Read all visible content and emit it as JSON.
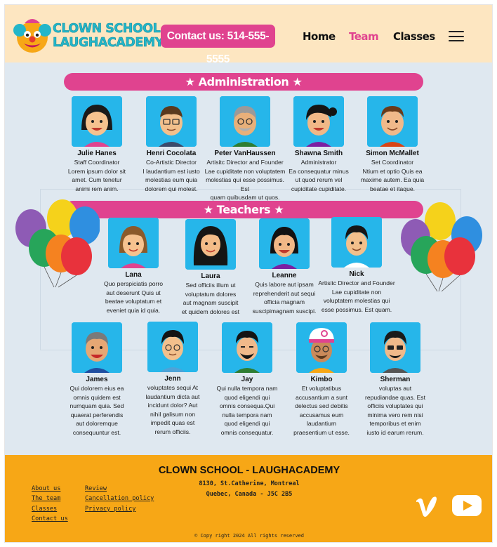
{
  "header": {
    "logo_line1": "CLOWN SCHOOL",
    "logo_line2": "LAUGHACADEMY",
    "contact_label": "Contact us: 514-555-5555",
    "nav": [
      {
        "label": "Home",
        "active": false
      },
      {
        "label": "Team",
        "active": true
      },
      {
        "label": "Classes",
        "active": false
      }
    ],
    "menu_icon": "hamburger-menu-icon"
  },
  "sections": {
    "administration": "★ Administration ★",
    "teachers": "★ Teachers ★"
  },
  "administration": [
    {
      "name": "Julie Hanes",
      "role": "Staff Coordinator",
      "bio": [
        "Lorem ipsum dolor sit",
        "amet. Cum tenetur",
        "animi rem anim."
      ]
    },
    {
      "name": "Henri Cocolata",
      "role": "Co-Artistic Director",
      "bio": [
        "I laudantium est  iusto",
        "molestias eum quia",
        "dolorem qui molest."
      ]
    },
    {
      "name": "Peter VanHaussen",
      "role": "Artisitc Director and Founder",
      "bio": [
        "Lae cupiditate non voluptatem",
        "molestias qui esse possimus. Est",
        "quam quibusdam ut quos."
      ]
    },
    {
      "name": "Shawna Smith",
      "role": "Administrator",
      "bio": [
        "Ea consequatur minus",
        "ut quod rerum vel",
        "cupiditate cupiditate."
      ]
    },
    {
      "name": "Simon McMallet",
      "role": "Set Coordinator",
      "bio": [
        "Ntium et optio Quis ea",
        "maxime autem. Ea quia",
        "beatae et itaque."
      ]
    }
  ],
  "teachers": [
    {
      "name": "Lana",
      "bio": [
        "Quo perspiciatis porro",
        "aut deserunt Quis ut",
        "beatae voluptatum  et",
        "eveniet quia id quia."
      ]
    },
    {
      "name": "Laura",
      "bio": [
        "Sed officiis illum ut",
        "voluptatum dolores",
        "aut magnam suscipit",
        "et quidem dolores est"
      ]
    },
    {
      "name": "Leanne",
      "bio": [
        "Quis labore aut ipsam",
        "reprehenderit aut sequi",
        "officia magnam",
        "suscipimagnam suscipi."
      ]
    },
    {
      "name": "Nick",
      "bio": [
        "Artisitc Director and Founder",
        "Lae cupiditate non",
        "voluptatem  molestias qui",
        "esse possimus. Est quam."
      ]
    },
    {
      "name": "James",
      "bio": [
        "Qui dolorem eius ea",
        "omnis quidem est",
        "numquam quia. Sed",
        "quaerat  perferendis",
        "aut doloremque",
        "consequuntur est."
      ]
    },
    {
      "name": "Jenn",
      "bio": [
        "voluptates sequi At",
        "laudantium dicta aut",
        "incidunt dolor? Aut",
        "nihil galisum non",
        "impedit quas  est",
        "rerum officiis."
      ]
    },
    {
      "name": "Jay",
      "bio": [
        "Qui nulla tempora nam",
        "quod eligendi qui",
        "omnis  consequa.Qui",
        "nulla tempora nam",
        "quod eligendi qui",
        "omnis  consequatur."
      ]
    },
    {
      "name": "Kimbo",
      "bio": [
        "Et voluptatibus",
        "accusantium a sunt",
        "delectus sed debitis",
        "accusamus eum",
        "laudantium",
        "praesentium ut esse."
      ]
    },
    {
      "name": "Sherman",
      "bio": [
        "voluptas aut",
        "repudiandae quas. Est",
        "officiis voluptates qui",
        "minima vero rem nisi",
        "temporibus et enim",
        "iusto  id earum rerum."
      ]
    }
  ],
  "footer": {
    "title": "CLOWN SCHOOL - LAUGHACADEMY",
    "address1": "8130, St.Catherine, Montreal",
    "address2": "Quebec, Canada - J5C 2B5",
    "links_col1": [
      "About us",
      "The team",
      "Classes",
      "Contact us"
    ],
    "links_col2": [
      "Review",
      "Cancellation policy",
      "Privacy policy"
    ],
    "copyright": "© Copy right 2024 All rights reserved",
    "social_icons": [
      "vimeo-icon",
      "youtube-icon"
    ]
  },
  "colors": {
    "header_bg": "#fde6c1",
    "accent_pink": "#e0438f",
    "logo_teal": "#23b6c9",
    "main_bg": "#dfe8f0",
    "avatar_bg": "#26b6ea",
    "footer_bg": "#f7a716"
  }
}
